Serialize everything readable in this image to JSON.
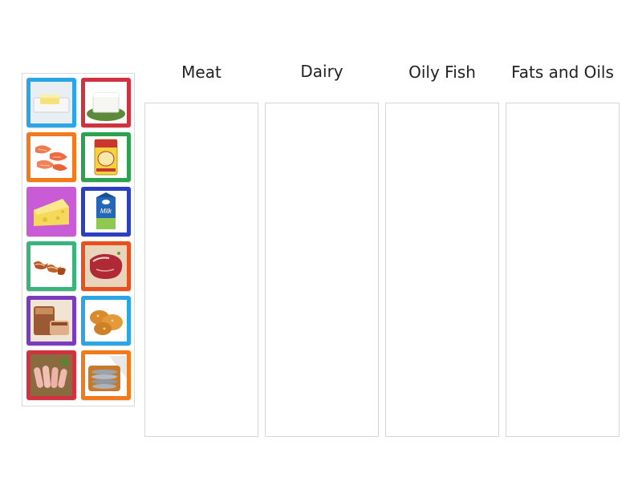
{
  "categories": [
    {
      "label": "Meat"
    },
    {
      "label": "Dairy"
    },
    {
      "label": "Oily Fish"
    },
    {
      "label": "Fats and Oils"
    }
  ],
  "cards": [
    {
      "item": "butter",
      "frame_color": "#2aa6e6"
    },
    {
      "item": "feta-cheese",
      "frame_color": "#d23140"
    },
    {
      "item": "salmon-fillets",
      "frame_color": "#f27a1a"
    },
    {
      "item": "ghee-tin",
      "frame_color": "#2aa24f"
    },
    {
      "item": "cheese-wedge",
      "frame_color": "#c95bd6"
    },
    {
      "item": "milk-carton",
      "frame_color": "#2c3fc2"
    },
    {
      "item": "bacon",
      "frame_color": "#3ab37c"
    },
    {
      "item": "steak",
      "frame_color": "#e8501e"
    },
    {
      "item": "roast-pork",
      "frame_color": "#7b3bbf"
    },
    {
      "item": "fried-chicken",
      "frame_color": "#2aa6e6"
    },
    {
      "item": "sausages",
      "frame_color": "#d23140"
    },
    {
      "item": "sardines",
      "frame_color": "#f27a1a"
    }
  ],
  "milk_label": "Milk"
}
